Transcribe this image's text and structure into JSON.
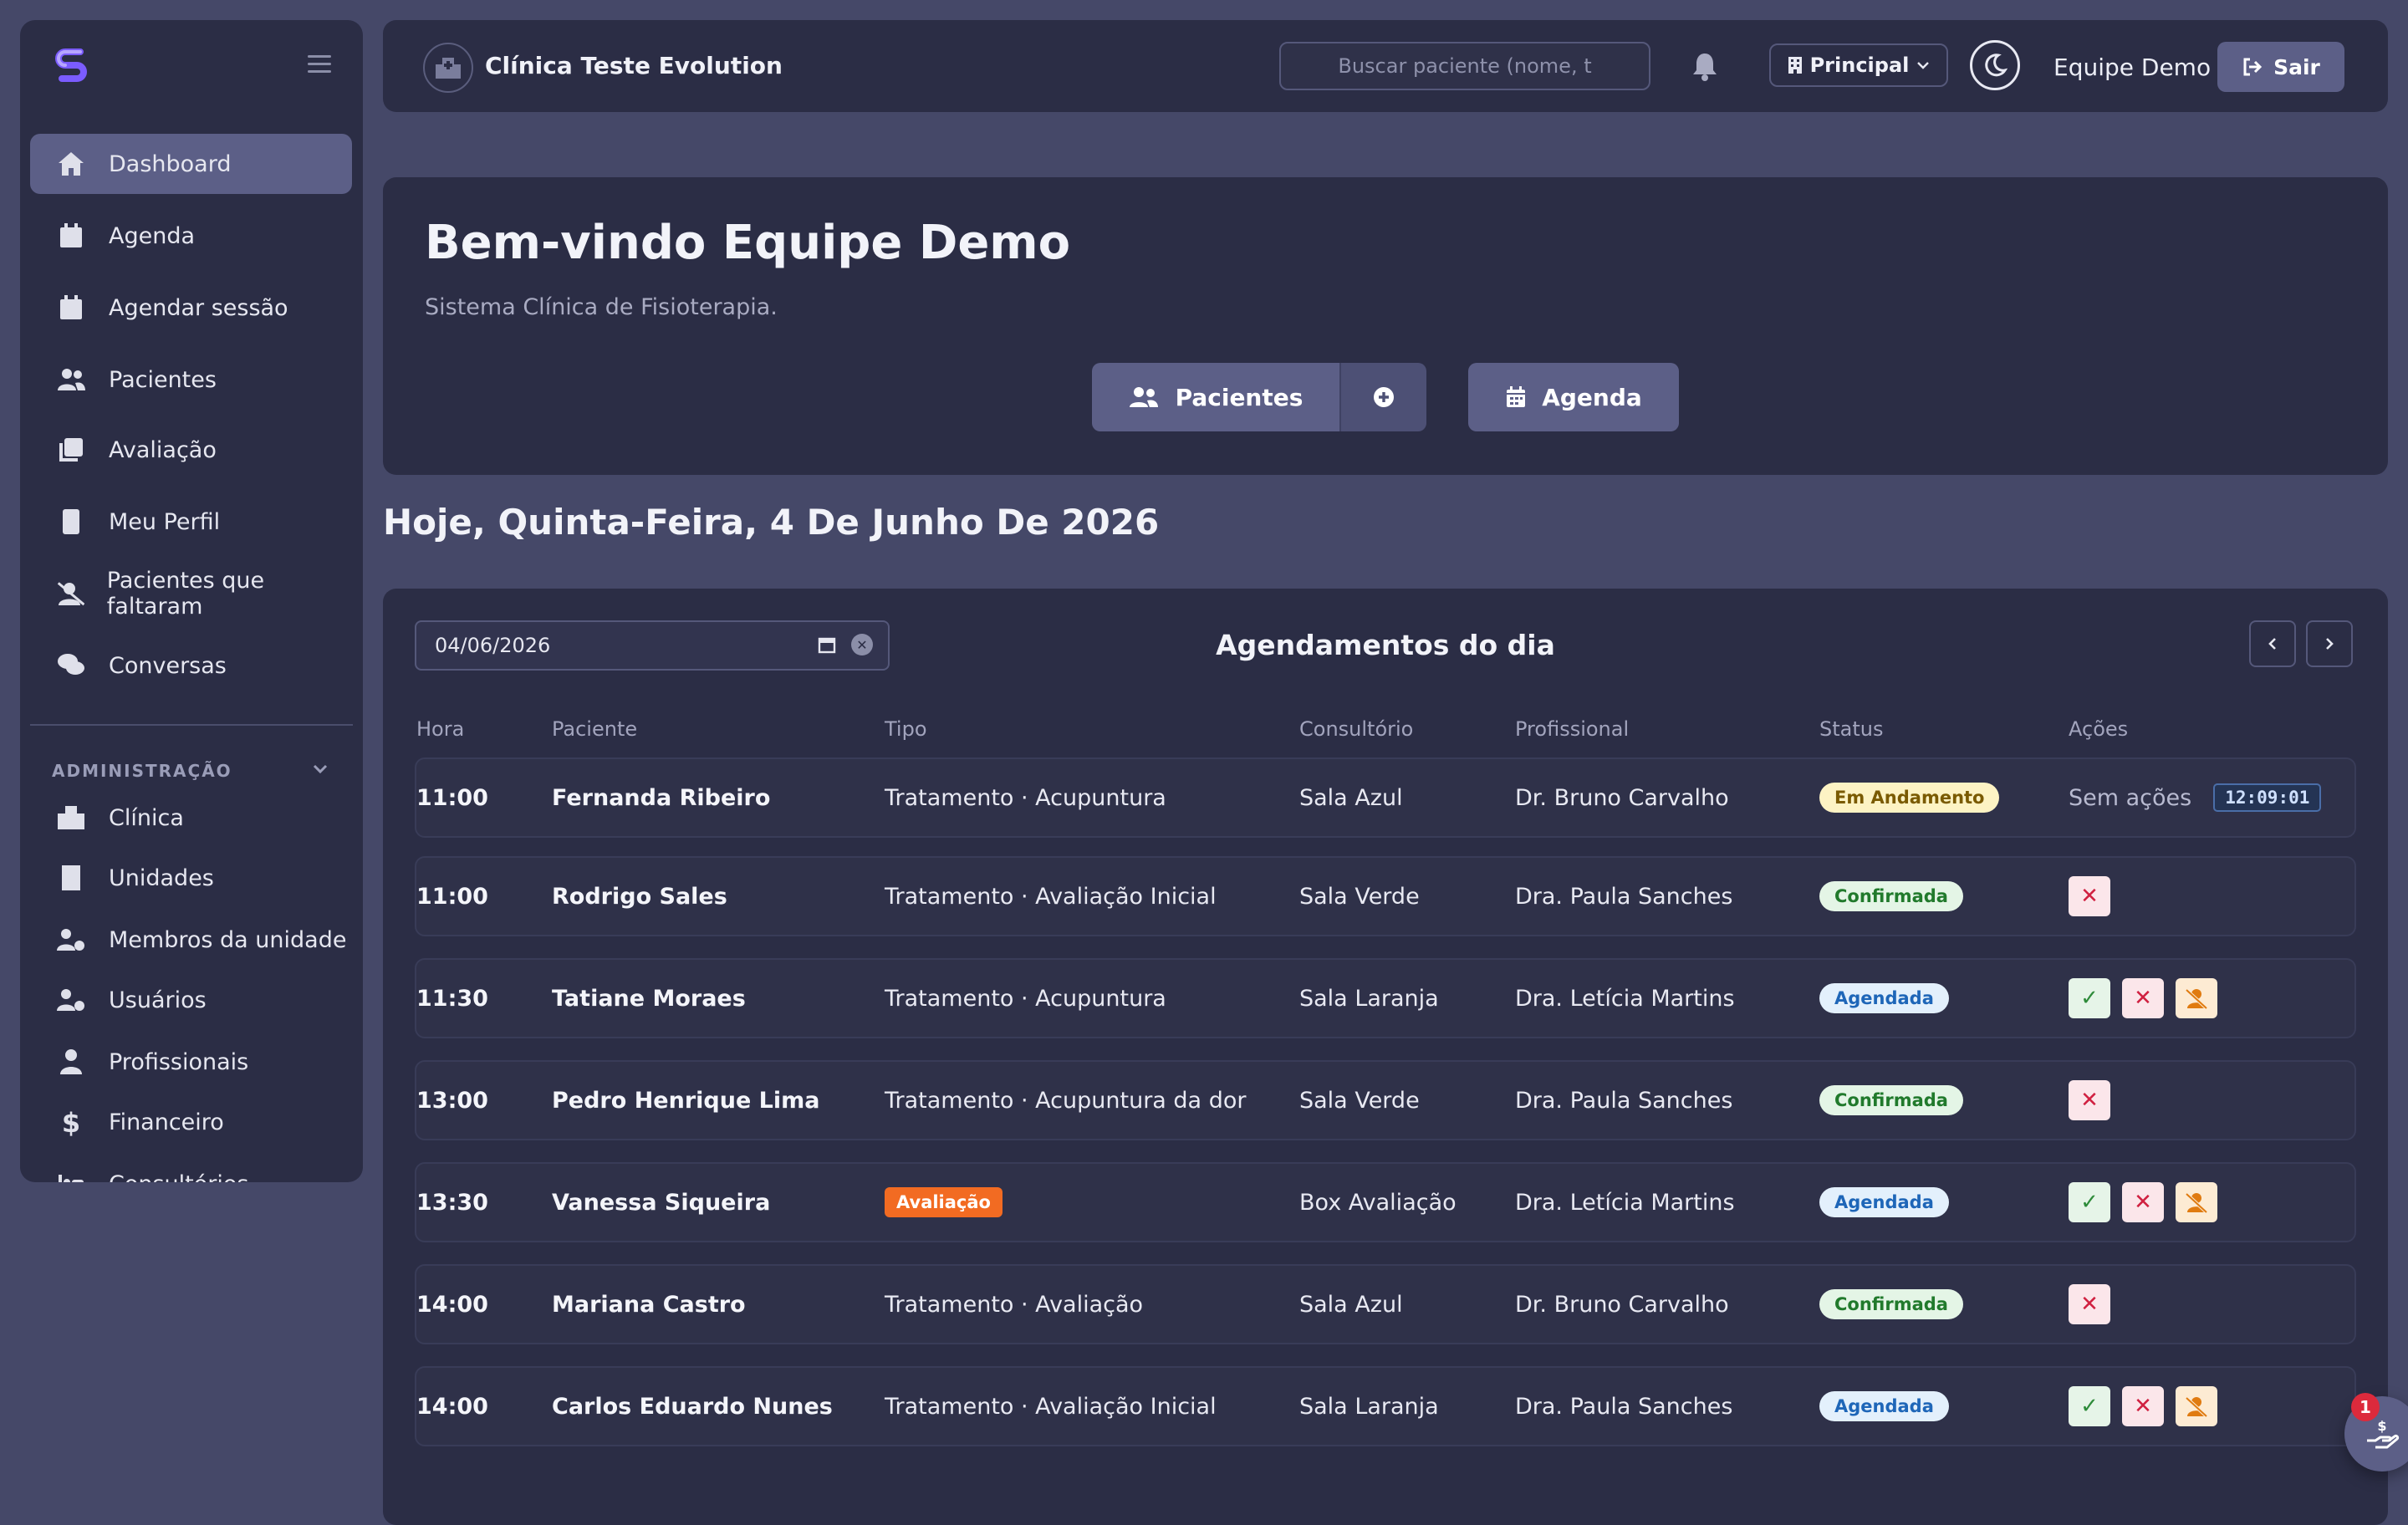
{
  "sidebar": {
    "items": [
      {
        "label": "Dashboard",
        "icon": "home-icon",
        "active": true
      },
      {
        "label": "Agenda",
        "icon": "calendar-icon"
      },
      {
        "label": "Agendar sessão",
        "icon": "calendar-plus-icon"
      },
      {
        "label": "Pacientes",
        "icon": "users-icon"
      },
      {
        "label": "Avaliação",
        "icon": "clipboard-plus-icon"
      },
      {
        "label": "Meu Perfil",
        "icon": "id-badge-icon"
      },
      {
        "label": "Pacientes que faltaram",
        "icon": "user-slash-icon"
      },
      {
        "label": "Conversas",
        "icon": "comments-icon"
      }
    ],
    "admin_section": "ADMINISTRAÇÃO",
    "admin_items": [
      {
        "label": "Clínica",
        "icon": "hospital-icon"
      },
      {
        "label": "Unidades",
        "icon": "building-icon"
      },
      {
        "label": "Membros da unidade",
        "icon": "users-cog-icon"
      },
      {
        "label": "Usuários",
        "icon": "users-gear-icon"
      },
      {
        "label": "Profissionais",
        "icon": "user-doctor-icon"
      },
      {
        "label": "Financeiro",
        "icon": "dollar-icon"
      },
      {
        "label": "Consultórios",
        "icon": "bed-icon"
      }
    ]
  },
  "header": {
    "clinic_name": "Clínica Teste Evolution",
    "search_placeholder": "Buscar paciente (nome, t",
    "unit_selected": "Principal",
    "user_name": "Equipe Demo",
    "logout_label": "Sair"
  },
  "welcome": {
    "title": "Bem-vindo Equipe Demo",
    "subtitle": "Sistema Clínica de Fisioterapia.",
    "patients_button": "Pacientes",
    "agenda_button": "Agenda"
  },
  "today_label": "Hoje, Quinta-Feira, 4 De Junho De 2026",
  "appointments": {
    "date_value": "04/06/2026",
    "title": "Agendamentos do dia",
    "columns": [
      "Hora",
      "Paciente",
      "Tipo",
      "Consultório",
      "Profissional",
      "Status",
      "Ações"
    ],
    "rows": [
      {
        "hora": "11:00",
        "paciente": "Fernanda Ribeiro",
        "tipo": "Tratamento · Acupuntura",
        "consultorio": "Sala Azul",
        "profissional": "Dr. Bruno Carvalho",
        "status": "Em Andamento",
        "status_kind": "andamento",
        "acoes_text": "Sem ações",
        "timer": "12:09:01"
      },
      {
        "hora": "11:00",
        "paciente": "Rodrigo Sales",
        "tipo": "Tratamento · Avaliação Inicial",
        "consultorio": "Sala Verde",
        "profissional": "Dra. Paula Sanches",
        "status": "Confirmada",
        "status_kind": "confirmada",
        "actions": [
          "cancel"
        ]
      },
      {
        "hora": "11:30",
        "paciente": "Tatiane Moraes",
        "tipo": "Tratamento · Acupuntura",
        "consultorio": "Sala Laranja",
        "profissional": "Dra. Letícia Martins",
        "status": "Agendada",
        "status_kind": "agendada",
        "actions": [
          "confirm",
          "cancel",
          "no-show"
        ]
      },
      {
        "hora": "13:00",
        "paciente": "Pedro Henrique Lima",
        "tipo": "Tratamento · Acupuntura da dor",
        "consultorio": "Sala Verde",
        "profissional": "Dra. Paula Sanches",
        "status": "Confirmada",
        "status_kind": "confirmada",
        "actions": [
          "cancel"
        ]
      },
      {
        "hora": "13:30",
        "paciente": "Vanessa Siqueira",
        "tipo_badge": "Avaliação",
        "consultorio": "Box Avaliação",
        "profissional": "Dra. Letícia Martins",
        "status": "Agendada",
        "status_kind": "agendada",
        "actions": [
          "confirm",
          "cancel",
          "no-show"
        ]
      },
      {
        "hora": "14:00",
        "paciente": "Mariana Castro",
        "tipo": "Tratamento · Avaliação",
        "consultorio": "Sala Azul",
        "profissional": "Dr. Bruno Carvalho",
        "status": "Confirmada",
        "status_kind": "confirmada",
        "actions": [
          "cancel"
        ]
      },
      {
        "hora": "14:00",
        "paciente": "Carlos Eduardo Nunes",
        "tipo": "Tratamento · Avaliação Inicial",
        "consultorio": "Sala Laranja",
        "profissional": "Dra. Paula Sanches",
        "status": "Agendada",
        "status_kind": "agendada",
        "actions": [
          "confirm",
          "cancel",
          "no-show"
        ]
      }
    ]
  },
  "fab": {
    "badge_count": "1",
    "icon": "hand-dollar-icon"
  },
  "colors": {
    "background": "#454868",
    "panel": "#2b2d45",
    "accent": "#5c5f87",
    "evaluation_badge": "#f26b22"
  }
}
